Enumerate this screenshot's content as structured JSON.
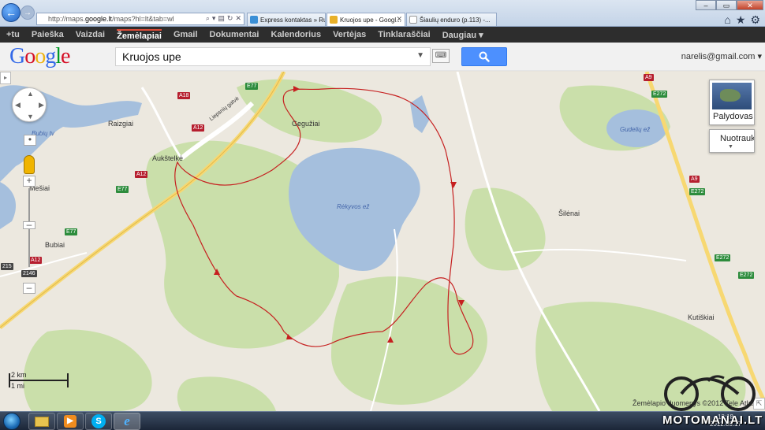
{
  "browser": {
    "address_url_prefix": "http://maps.",
    "address_url_host": "google.lt",
    "address_url_suffix": "/maps?hl=lt&tab=wl",
    "tabs": [
      {
        "label": "Express kontaktas » Ru...",
        "active": false
      },
      {
        "label": "Kruojos upe - Googl...",
        "active": true
      },
      {
        "label": "Šiaulių enduro (p.113) -...",
        "active": false
      }
    ],
    "tools": [
      "home-icon",
      "star-icon",
      "gear-icon"
    ]
  },
  "gbar": {
    "items": [
      "+tu",
      "Paieška",
      "Vaizdai",
      "Žemėlapiai",
      "Gmail",
      "Dokumentai",
      "Kalendorius",
      "Vertėjas",
      "Tinklaraščiai",
      "Daugiau ▾"
    ],
    "active_index": 3
  },
  "header": {
    "logo": [
      "G",
      "o",
      "o",
      "g",
      "l",
      "e"
    ],
    "search_value": "Kruojos upe",
    "account": "narelis@gmail.com ▾"
  },
  "map": {
    "places": [
      {
        "name": "Raizgiai"
      },
      {
        "name": "Gegužiai"
      },
      {
        "name": "Aukštelkė"
      },
      {
        "name": "Mešiai"
      },
      {
        "name": "Bubiai"
      },
      {
        "name": "Šilėnai"
      },
      {
        "name": "Kutiškiai"
      }
    ],
    "lakes": [
      {
        "name": "Rėkyvos ež"
      },
      {
        "name": "Gudelių ež"
      },
      {
        "name": "Bubių tv"
      }
    ],
    "street": "Liepsnių gatvė",
    "road_shields": {
      "E77_a": "E77",
      "E77_b": "E77",
      "E77_c": "E77",
      "A18": "A18",
      "A12_a": "A12",
      "A12_b": "A12",
      "A12_c": "A12",
      "A9_a": "A9",
      "A9_b": "A9",
      "E272_a": "E272",
      "E272_b": "E272",
      "E272_c": "E272",
      "E272_d": "E272",
      "r215": "215",
      "r2146": "2146"
    },
    "controls": {
      "satellite_label": "Palydovas",
      "photos_label": "Nuotrauk",
      "scale_km": "2 km",
      "scale_mi": "1 mi"
    },
    "copyright": "Žemėlapio duomenys ©2012 Tele Atlas"
  },
  "taskbar": {
    "apps": [
      "windows-explorer-icon",
      "media-player-icon",
      "skype-icon",
      "internet-explorer-icon"
    ],
    "tray_lang": "LT",
    "clock_time": "13:18",
    "clock_date": "2012.05.17"
  },
  "watermark": "MOTOMANAI.LT",
  "colors": {
    "water": "#a5bfdd",
    "forest": "#cadfaa",
    "route": "#c62020",
    "highway": "#f7d872"
  }
}
